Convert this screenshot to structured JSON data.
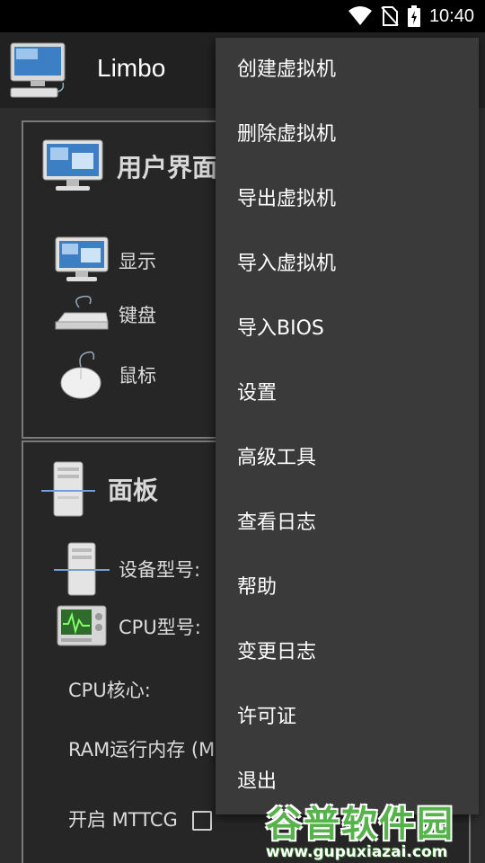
{
  "status_bar": {
    "time": "10:40",
    "icons": [
      "wifi-icon",
      "no-sim-icon",
      "battery-charging-icon"
    ]
  },
  "app_bar": {
    "title": "Limbo",
    "icon": "computer-icon"
  },
  "ui_card": {
    "title": "用户界面",
    "items": [
      {
        "label": "显示",
        "icon": "display-icon"
      },
      {
        "label": "键盘",
        "icon": "keyboard-icon"
      },
      {
        "label": "鼠标",
        "icon": "mouse-icon"
      }
    ]
  },
  "panel_card": {
    "title": "面板",
    "items": [
      {
        "label": "设备型号:",
        "icon": "server-tower-icon"
      },
      {
        "label": "CPU型号:",
        "icon": "cpu-monitor-icon"
      }
    ],
    "cpu_cores_label": "CPU核心:",
    "ram_label": "RAM运行内存 (M",
    "mttcg_label": "开启 MTTCG"
  },
  "menu": {
    "items": [
      "创建虚拟机",
      "删除虚拟机",
      "导出虚拟机",
      "导入虚拟机",
      "导入BIOS",
      "设置",
      "高级工具",
      "查看日志",
      "帮助",
      "变更日志",
      "许可证",
      "退出"
    ]
  },
  "watermark": {
    "text": "谷普软件园",
    "url": "www.gupuxiazai.com"
  }
}
